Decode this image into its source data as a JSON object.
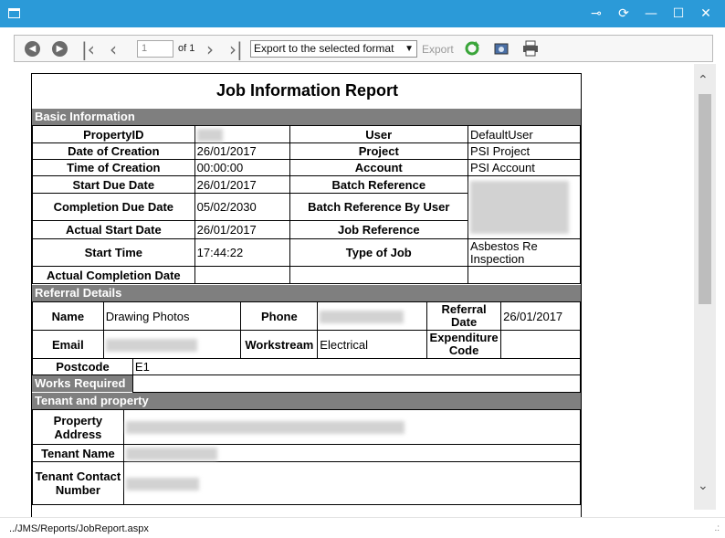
{
  "window": {
    "controls": {
      "pin": "⊸",
      "refresh": "⟳",
      "minimize": "—",
      "maximize": "☐",
      "close": "✕"
    }
  },
  "toolbar": {
    "first_icon": "◀",
    "prev_icon": "▶",
    "first_page": "|‹",
    "prev_page": "‹",
    "next_page": "›",
    "last_page": "›|",
    "page_value": "1",
    "page_count_label": "of 1",
    "format_selected": "Export to the selected format",
    "export_label": "Export",
    "icons": [
      "refresh-icon",
      "print-preview-icon",
      "print-icon"
    ]
  },
  "report": {
    "title": "Job Information Report",
    "basic": {
      "header": "Basic Information",
      "rows": [
        {
          "l1": "PropertyID",
          "v1": "",
          "l2": "User",
          "v2": "DefaultUser"
        },
        {
          "l1": "Date of Creation",
          "v1": "26/01/2017",
          "l2": "Project",
          "v2": "PSI Project"
        },
        {
          "l1": "Time of Creation",
          "v1": "00:00:00",
          "l2": "Account",
          "v2": "PSI Account"
        },
        {
          "l1": "Start Due Date",
          "v1": "26/01/2017",
          "l2": "Batch Reference",
          "v2": ""
        },
        {
          "l1": "Completion Due Date",
          "v1": "05/02/2030",
          "l2": "Batch Reference By User",
          "v2": ""
        },
        {
          "l1": "Actual Start Date",
          "v1": "26/01/2017",
          "l2": "Job Reference",
          "v2": ""
        },
        {
          "l1": "Start Time",
          "v1": "17:44:22",
          "l2": "Type of Job",
          "v2": "Asbestos Re Inspection"
        },
        {
          "l1": "Actual Completion Date",
          "v1": "",
          "l2": "",
          "v2": ""
        }
      ]
    },
    "referral": {
      "header": "Referral Details",
      "name_label": "Name",
      "name_value": "Drawing Photos",
      "phone_label": "Phone",
      "phone_value": "",
      "ref_date_label": "Referral Date",
      "ref_date_value": "26/01/2017",
      "email_label": "Email",
      "email_value": "",
      "workstream_label": "Workstream",
      "workstream_value": "Electrical",
      "expcode_label": "Expenditure Code",
      "expcode_value": "",
      "postcode_label": "Postcode",
      "postcode_value": "E1"
    },
    "works_required": {
      "header": "Works Required"
    },
    "tenant": {
      "header": "Tenant and property",
      "address_label": "Property Address",
      "tenant_name_label": "Tenant Name",
      "contact_label": "Tenant Contact Number"
    }
  },
  "status": {
    "url": "../JMS/Reports/JobReport.aspx",
    "grip": ".:"
  }
}
